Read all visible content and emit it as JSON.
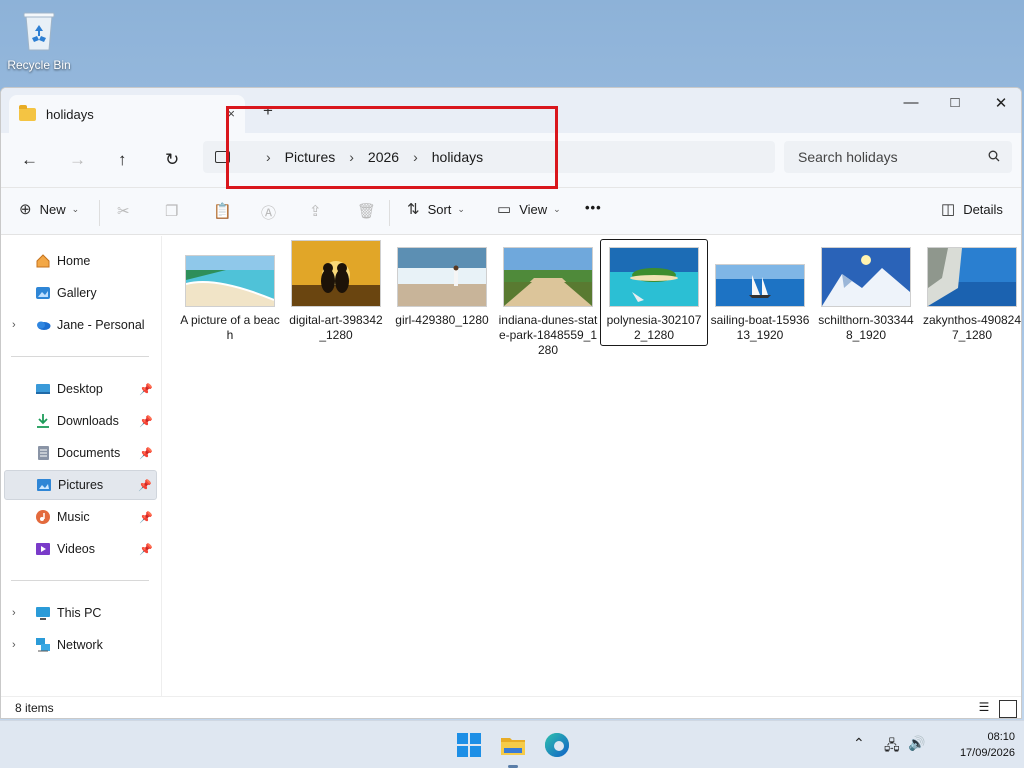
{
  "desktop": {
    "recycle_bin_label": "Recycle Bin"
  },
  "window": {
    "tab_title": "holidays",
    "tab_close": "×",
    "new_tab": "+",
    "minimize": "—",
    "maximize": "□",
    "close": "✕"
  },
  "nav": {
    "back": "←",
    "forward": "→",
    "up": "↑",
    "refresh": "↻",
    "breadcrumb": [
      "Pictures",
      "2026",
      "holidays"
    ],
    "separator": "›",
    "search_placeholder": "Search holidays"
  },
  "commands": {
    "new": "New",
    "sort": "Sort",
    "view": "View",
    "more": "•••",
    "details": "Details"
  },
  "sidebar": {
    "items": [
      {
        "label": "Home",
        "icon": "home-icon"
      },
      {
        "label": "Gallery",
        "icon": "gallery-icon"
      },
      {
        "label": "Jane - Personal",
        "icon": "onedrive-icon"
      }
    ],
    "pinned": [
      {
        "label": "Desktop",
        "icon": "desktop-icon"
      },
      {
        "label": "Downloads",
        "icon": "downloads-icon"
      },
      {
        "label": "Documents",
        "icon": "documents-icon"
      },
      {
        "label": "Pictures",
        "icon": "pictures-icon",
        "selected": true
      },
      {
        "label": "Music",
        "icon": "music-icon"
      },
      {
        "label": "Videos",
        "icon": "videos-icon"
      }
    ],
    "devices": [
      {
        "label": "This PC",
        "icon": "this-pc-icon"
      },
      {
        "label": "Network",
        "icon": "network-icon"
      }
    ]
  },
  "files": [
    {
      "name": "A picture of a beach"
    },
    {
      "name": "digital-art-398342_1280"
    },
    {
      "name": "girl-429380_1280"
    },
    {
      "name": "indiana-dunes-state-park-1848559_1280"
    },
    {
      "name": "polynesia-3021072_1280",
      "selected": true
    },
    {
      "name": "sailing-boat-1593613_1920"
    },
    {
      "name": "schilthorn-3033448_1920"
    },
    {
      "name": "zakynthos-4908247_1280"
    }
  ],
  "status": {
    "item_count": "8 items"
  },
  "taskbar": {
    "time": "08:10",
    "date": "17/09/2026"
  }
}
